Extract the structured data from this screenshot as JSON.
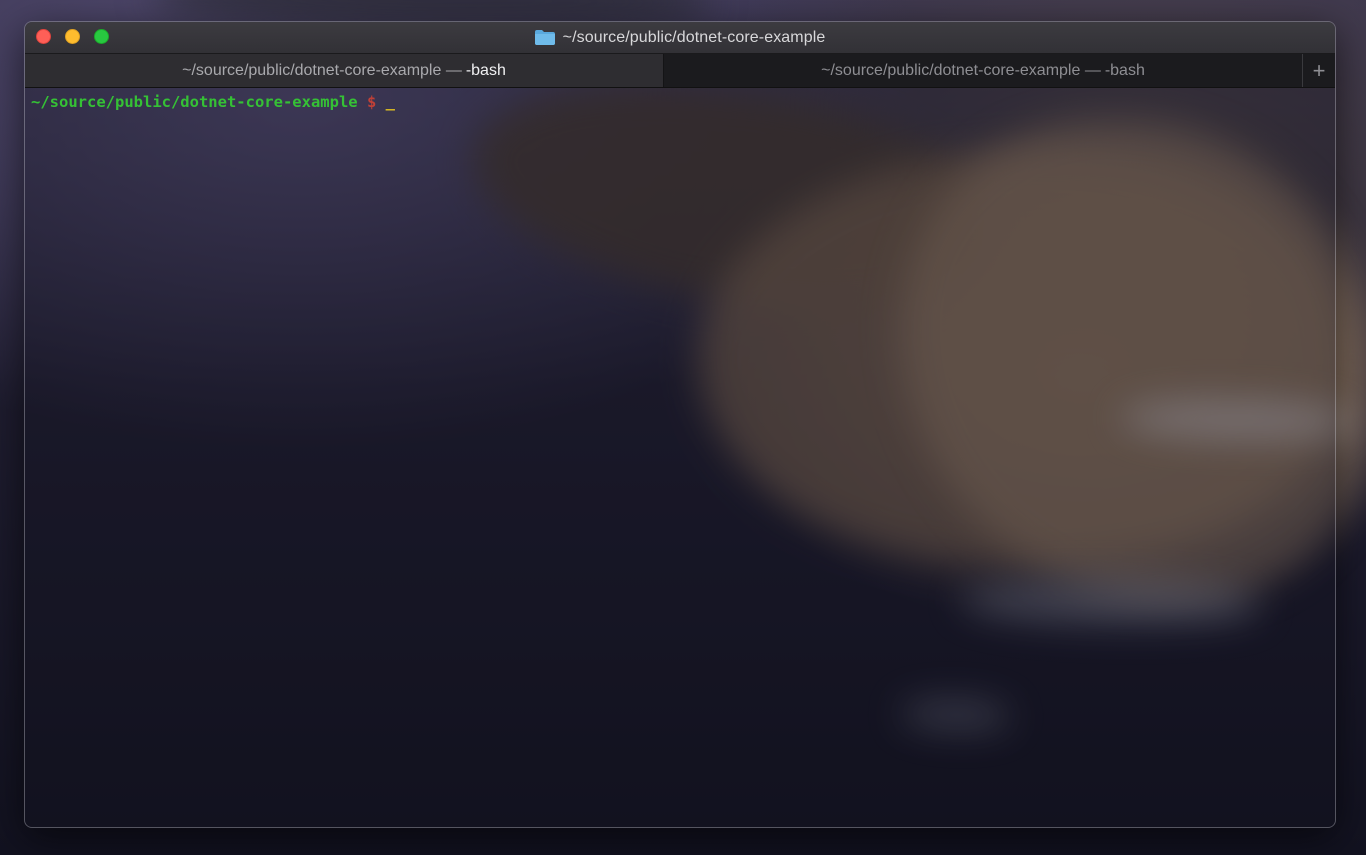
{
  "window": {
    "title": "~/source/public/dotnet-core-example",
    "title_icon": "folder-icon",
    "traffic_lights": {
      "close_color": "#fe5f57",
      "minimize_color": "#febc2e",
      "maximize_color": "#28c840"
    }
  },
  "tabs": [
    {
      "path": "~/source/public/dotnet-core-example —",
      "process": "-bash",
      "active": true
    },
    {
      "path": "~/source/public/dotnet-core-example —",
      "process": "-bash",
      "active": false
    }
  ],
  "new_tab": {
    "label": "+"
  },
  "terminal": {
    "prompt_path": "~/source/public/dotnet-core-example",
    "prompt_symbol": "$",
    "cursor": "_",
    "colors": {
      "path": "#35c135",
      "symbol": "#c04037",
      "cursor": "#e0c020"
    }
  }
}
